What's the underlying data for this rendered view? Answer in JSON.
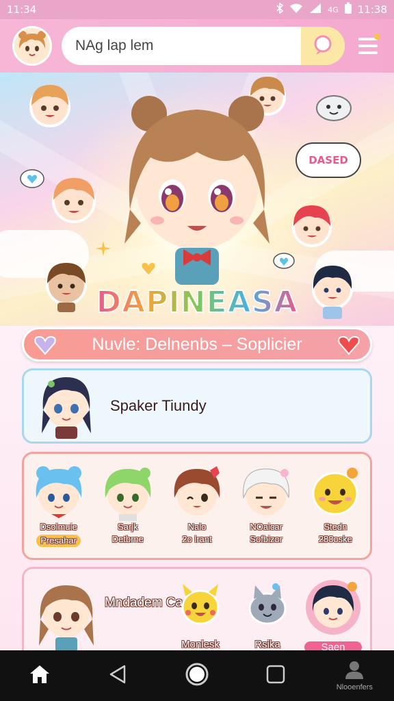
{
  "status_bar": {
    "time_left": "11:34",
    "time_right": "11:38",
    "network": "4G"
  },
  "header": {
    "search_value": "NAg lap lem",
    "icons": [
      "avatar",
      "search-icon",
      "menu-icon"
    ]
  },
  "hero": {
    "logo": "DAPINEASA",
    "speech_bubble": "DASED"
  },
  "banner": {
    "title": "Nuvle: Delnenbs – Soplicier",
    "left_icon": "heart-gem-icon",
    "right_icon": "heart-icon"
  },
  "featured": {
    "name": "Spaker Tiundy"
  },
  "friends": [
    {
      "name": "Dsolmuie",
      "sub": "Presahar"
    },
    {
      "name": "Sarjk",
      "sub": "Detbrne"
    },
    {
      "name": "Nalo",
      "sub": "2o lrant"
    },
    {
      "name": "NOaicar",
      "sub": "Sofbizor"
    },
    {
      "name": "Stedn",
      "sub": "280oske"
    }
  ],
  "bottom": {
    "title": "Mndadem Caol",
    "items": [
      {
        "label": "Monlesk"
      },
      {
        "label": "Rsika"
      },
      {
        "label": "Saen"
      }
    ]
  },
  "nav": {
    "right_label": "Nlooenfers"
  },
  "colors": {
    "accent_pink": "#f5a9cf",
    "banner_coral": "#f89b94",
    "featured_border": "#a9d7ec",
    "grid_border": "#f2a49c",
    "tag_yellow": "#f7c14a"
  }
}
